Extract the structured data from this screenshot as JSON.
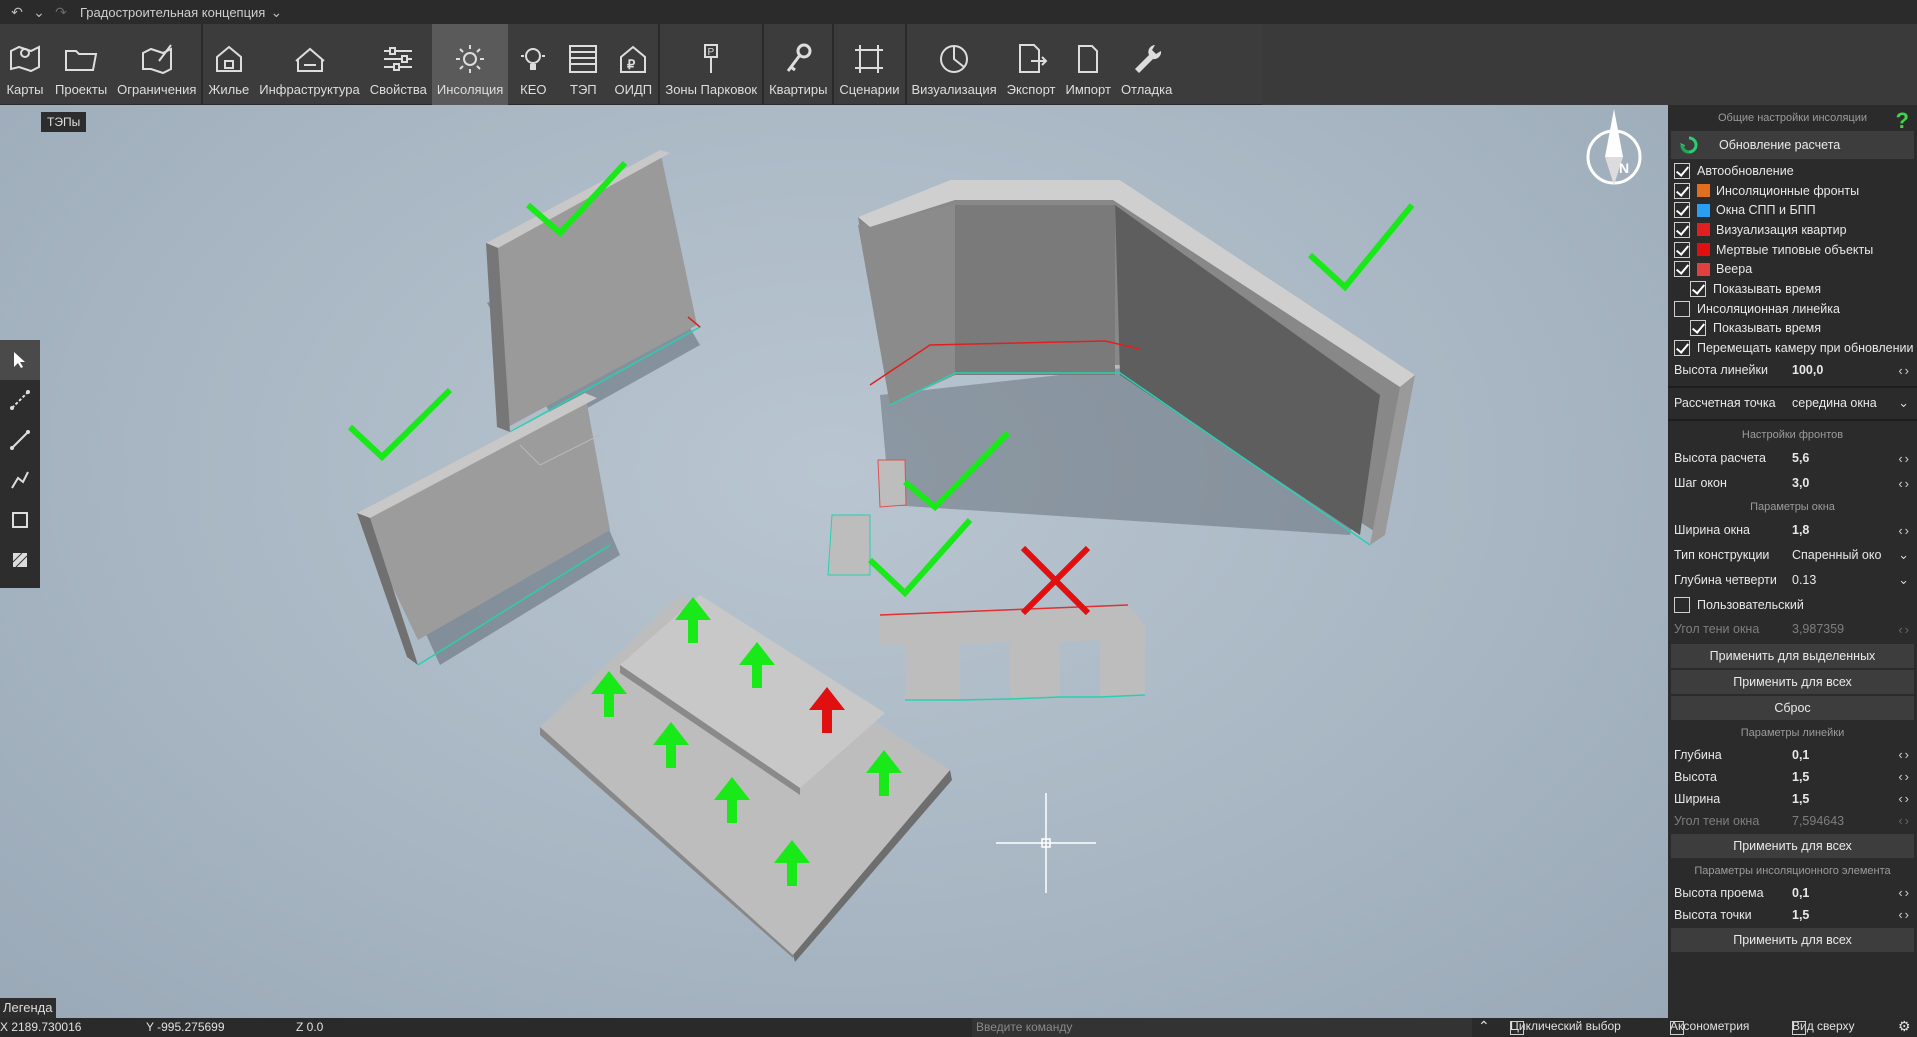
{
  "titlebar": {
    "title": "Градостроительная концепция"
  },
  "toolbar": {
    "items": [
      {
        "label": "Карты",
        "icon": "map-pin-icon"
      },
      {
        "label": "Проекты",
        "icon": "folder-icon"
      },
      {
        "label": "Ограничения",
        "icon": "restriction-map-icon"
      },
      {
        "label": "Жилье",
        "icon": "house-icon"
      },
      {
        "label": "Инфраструктура",
        "icon": "building-icon"
      },
      {
        "label": "Свойства",
        "icon": "sliders-icon"
      },
      {
        "label": "Инсоляция",
        "icon": "sun-icon"
      },
      {
        "label": "КЕО",
        "icon": "lightbulb-icon"
      },
      {
        "label": "ТЭП",
        "icon": "table-icon"
      },
      {
        "label": "ОИДП",
        "icon": "ruble-house-icon"
      },
      {
        "label": "Зоны Парковок",
        "icon": "parking-sign-icon"
      },
      {
        "label": "Квартиры",
        "icon": "key-icon"
      },
      {
        "label": "Сценарии",
        "icon": "scenario-icon"
      },
      {
        "label": "Визуализация",
        "icon": "pie-chart-icon"
      },
      {
        "label": "Экспорт",
        "icon": "export-icon"
      },
      {
        "label": "Импорт",
        "icon": "import-icon"
      },
      {
        "label": "Отладка",
        "icon": "wrench-icon"
      }
    ]
  },
  "viewport": {
    "tag": "ТЭПы",
    "legend": "Легенда",
    "compass": "N"
  },
  "panel": {
    "general_title": "Общие настройки инсоляции",
    "help": "?",
    "update_button": "Обновление расчета",
    "options": [
      {
        "label": "Автообновление",
        "checked": true,
        "indent": false,
        "color": ""
      },
      {
        "label": "Инсоляционные фронты",
        "checked": true,
        "indent": false,
        "color": "#e07020"
      },
      {
        "label": "Окна СПП и БПП",
        "checked": true,
        "indent": false,
        "color": "#2a9df4"
      },
      {
        "label": "Визуализация квартир",
        "checked": true,
        "indent": false,
        "color": "#e02020"
      },
      {
        "label": "Мертвые типовые объекты",
        "checked": true,
        "indent": false,
        "color": "#e01010"
      },
      {
        "label": "Веера",
        "checked": true,
        "indent": false,
        "color": "#e04040"
      },
      {
        "label": "Показывать время",
        "checked": true,
        "indent": true,
        "color": ""
      },
      {
        "label": "Инсоляционная линейка",
        "checked": false,
        "indent": false,
        "color": ""
      },
      {
        "label": "Показывать время",
        "checked": true,
        "indent": true,
        "color": ""
      },
      {
        "label": "Перемещать камеру при обновлении",
        "checked": true,
        "indent": false,
        "color": ""
      }
    ],
    "ruler_height": {
      "label": "Высота линейки",
      "value": "100,0"
    },
    "calc_point": {
      "label": "Рассчетная точка",
      "value": "середина окна"
    },
    "fronts_title": "Настройки фронтов",
    "calc_height": {
      "label": "Высота расчета",
      "value": "5,6"
    },
    "window_step": {
      "label": "Шаг окон",
      "value": "3,0"
    },
    "window_title": "Параметры окна",
    "window_width": {
      "label": "Ширина окна",
      "value": "1,8"
    },
    "construction_type": {
      "label": "Тип конструкции",
      "value": "Спаренный окон"
    },
    "quarter_depth": {
      "label": "Глубина четверти",
      "value": "0.13"
    },
    "custom": {
      "label": "Пользовательский",
      "checked": false
    },
    "window_shadow": {
      "label": "Угол тени окна",
      "value": "3,987359"
    },
    "apply_selected": "Применить для выделенных",
    "apply_all_1": "Применить для всех",
    "reset": "Сброс",
    "ruler_title": "Параметры линейки",
    "ruler_depth": {
      "label": "Глубина",
      "value": "0,1"
    },
    "ruler_h": {
      "label": "Высота",
      "value": "1,5"
    },
    "ruler_width": {
      "label": "Ширина",
      "value": "1,5"
    },
    "ruler_shadow": {
      "label": "Угол тени окна",
      "value": "7,594643"
    },
    "apply_all_2": "Применить для всех",
    "element_title": "Параметры инсоляционного элемента",
    "opening_height": {
      "label": "Высота проема",
      "value": "0,1"
    },
    "point_height": {
      "label": "Высота точки",
      "value": "1,5"
    },
    "apply_all_3": "Применить для всех"
  },
  "statusbar": {
    "x": "X 2189.730016",
    "y": "Y -995.275699",
    "z": "Z 0.0",
    "command_placeholder": "Введите команду",
    "cyclic": "Циклический выбор",
    "axonometry": "Аксонометрия",
    "top_view": "Вид сверху"
  }
}
